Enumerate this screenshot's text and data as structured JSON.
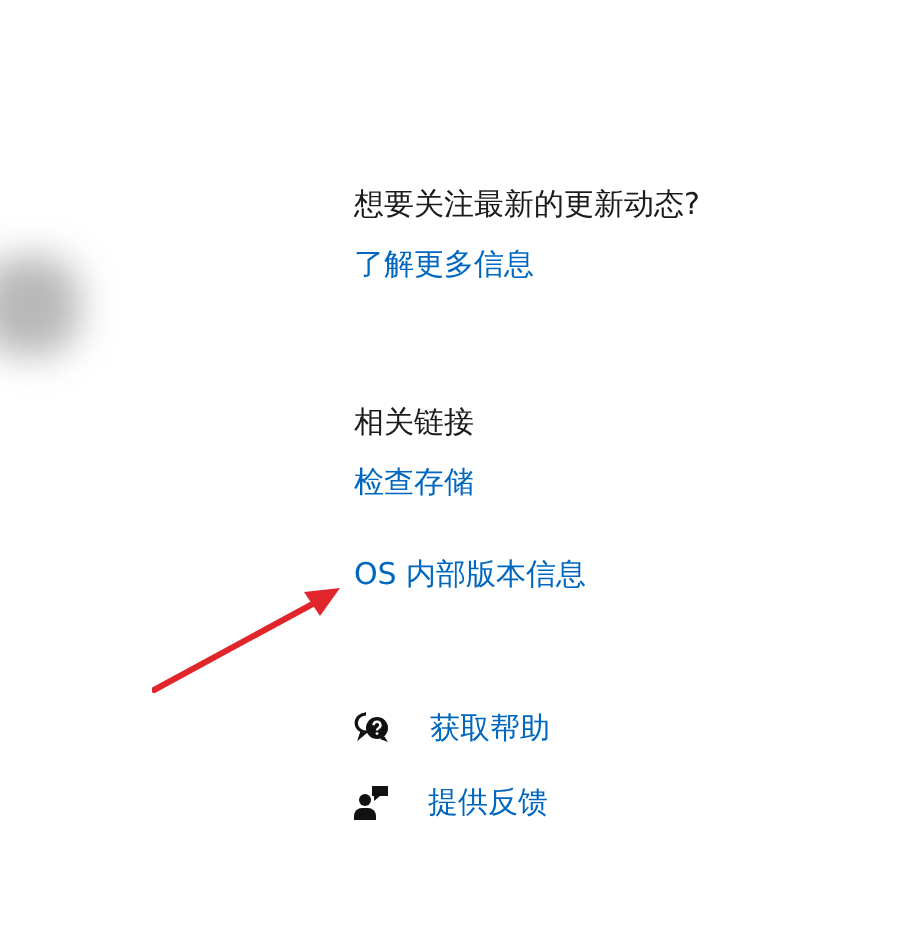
{
  "updates": {
    "question": "想要关注最新的更新动态?",
    "link": "了解更多信息"
  },
  "related": {
    "heading": "相关链接",
    "links": [
      "检查存储",
      "OS 内部版本信息"
    ]
  },
  "support": [
    {
      "kind": "help",
      "label": "获取帮助"
    },
    {
      "kind": "feedback",
      "label": "提供反馈"
    }
  ]
}
